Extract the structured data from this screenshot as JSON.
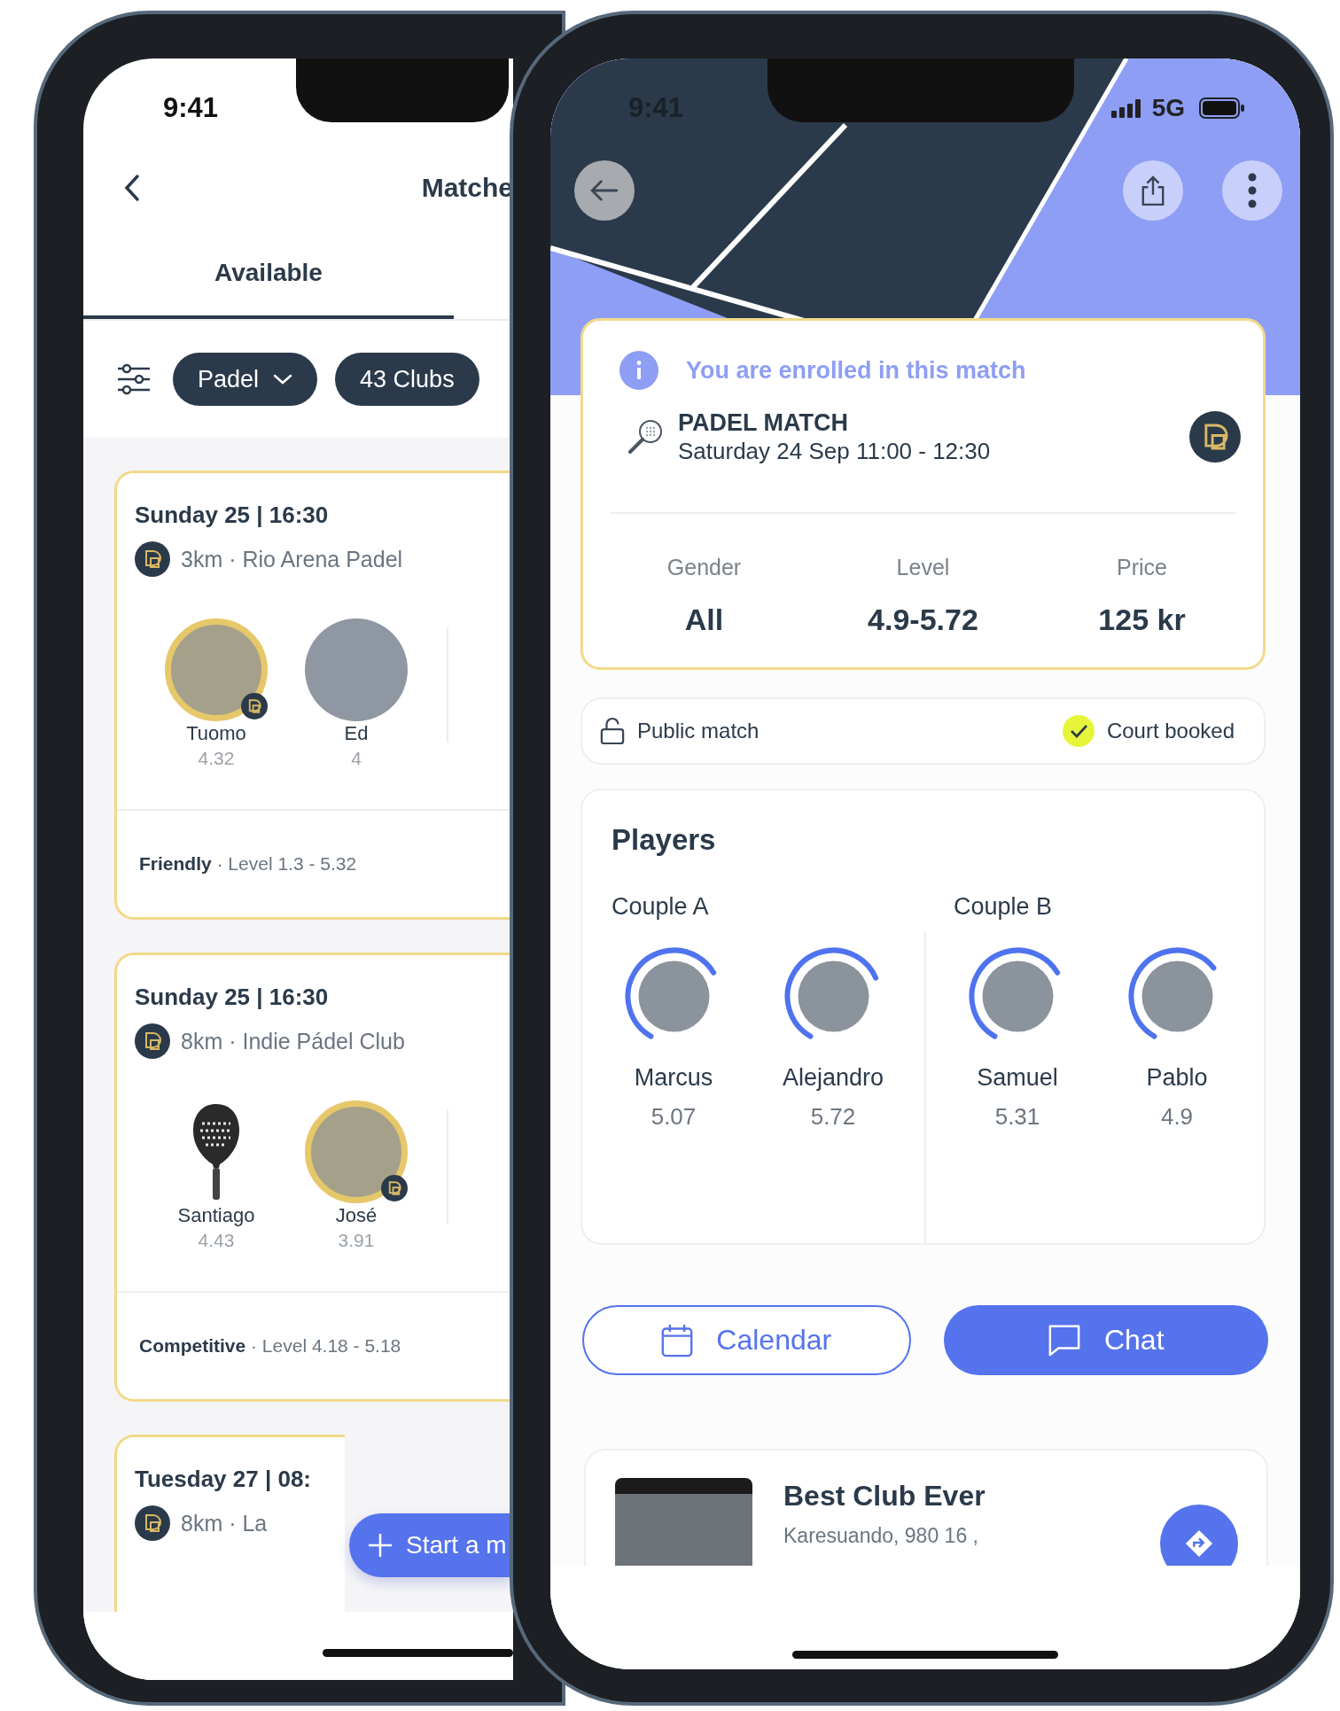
{
  "left_phone": {
    "status_bar": {
      "time": "9:41"
    },
    "header": {
      "title": "Matche"
    },
    "tabs": [
      {
        "label": "Available",
        "selected": true
      }
    ],
    "filters": [
      {
        "label": "Padel",
        "dropdown": true
      },
      {
        "label": "43 Clubs",
        "dropdown": false
      }
    ],
    "matches": [
      {
        "date": "Sunday 25 | 16:30",
        "location": "3km · Rio Arena Padel",
        "players": [
          {
            "name": "Tuomo",
            "rating": "4.32",
            "kind": "photo",
            "highlighted": true,
            "club_badge": true
          },
          {
            "name": "Ed",
            "rating": "4",
            "kind": "photo",
            "highlighted": false,
            "club_badge": false
          }
        ],
        "footer": "**Friendly** · Level 1.3 - 5.32"
      },
      {
        "date": "Sunday 25 | 16:30",
        "location": "8km · Indie Pádel Club",
        "players": [
          {
            "name": "Santiago",
            "rating": "4.43",
            "kind": "racket",
            "highlighted": false,
            "club_badge": false
          },
          {
            "name": "José",
            "rating": "3.91",
            "kind": "photo",
            "highlighted": true,
            "club_badge": true
          }
        ],
        "footer": "**Competitive** · Level 4.18 - 5.18"
      },
      {
        "date": "Tuesday 27 | 08:",
        "location": "8km · La"
      }
    ],
    "fab": {
      "label": "Start a m"
    }
  },
  "right_phone": {
    "status_bar": {
      "time": "9:41",
      "network": "5G"
    },
    "notice": "You are enrolled in this match",
    "match": {
      "title": "PADEL MATCH",
      "datetime": "Saturday 24 Sep 11:00 - 12:30"
    },
    "stats": [
      {
        "label": "Gender",
        "value": "All"
      },
      {
        "label": "Level",
        "value": "4.9-5.72"
      },
      {
        "label": "Price",
        "value": "125 kr"
      }
    ],
    "tags": [
      {
        "kind": "lock",
        "label": "Public match"
      },
      {
        "kind": "check",
        "label": "Court booked"
      }
    ],
    "players": {
      "title": "Players",
      "couples": [
        {
          "name": "Couple A",
          "players": [
            {
              "name": "Marcus",
              "rating": "5.07",
              "level": 0.58
            },
            {
              "name": "Alejandro",
              "rating": "5.72",
              "level": 0.6
            }
          ]
        },
        {
          "name": "Couple B",
          "players": [
            {
              "name": "Samuel",
              "rating": "5.31",
              "level": 0.58
            },
            {
              "name": "Pablo",
              "rating": "4.9",
              "level": 0.56
            }
          ]
        }
      ]
    },
    "actions": [
      {
        "kind": "calendar",
        "label": "Calendar"
      },
      {
        "kind": "chat",
        "label": "Chat"
      }
    ],
    "club": {
      "name": "Best Club Ever",
      "address": "Karesuando, 980 16 ,"
    }
  }
}
